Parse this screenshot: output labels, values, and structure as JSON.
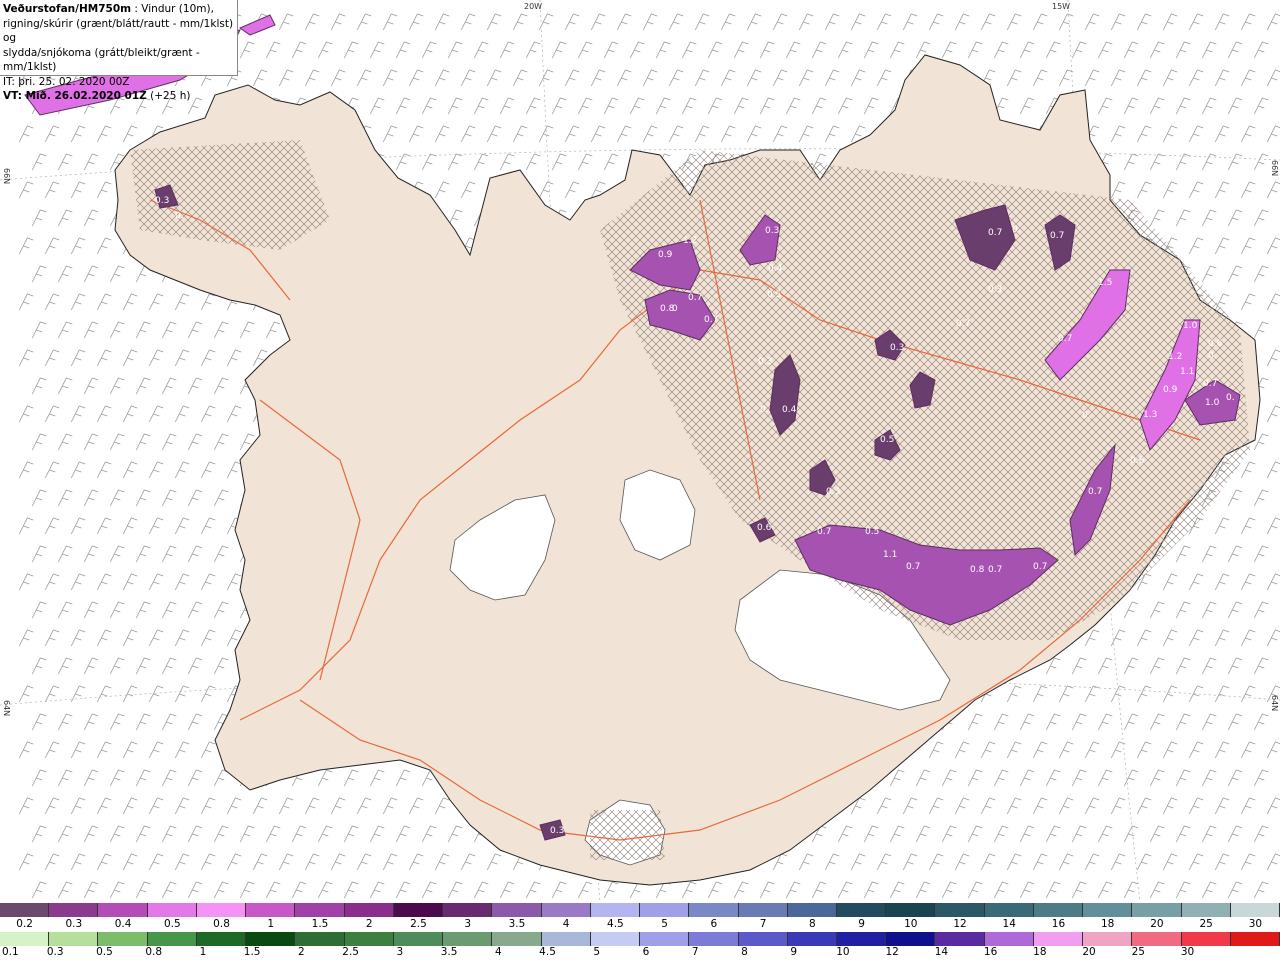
{
  "title": {
    "bold": "Veðurstofan/HM750m",
    "line1": " : Vindur (10m),",
    "line2": "rigning/skúrir (grænt/blátt/rautt - mm/1klst) og",
    "line3": "slydda/snjókoma (grátt/bleikt/grænt - mm/1klst)",
    "line4": "IT: þri. 25. 02. 2020 00Z",
    "vt_bold": "VT: Mið. 26.02.2020 01Z",
    "vt_rest": " (+25 h)"
  },
  "coords": {
    "lon20": "20W",
    "lon15": "15W",
    "lat66_left": "66N",
    "lat66_right": "66N",
    "lat64_left": "64N",
    "lat64_right": "64N"
  },
  "colors": {
    "land": "#f1e4d6",
    "glacier": "#ffffff",
    "road": "#e8683a",
    "snow_dark": "#5e2e5f",
    "snow_mid": "#a552b0",
    "snow_light": "#e070e6"
  },
  "legend_snow": {
    "labels": [
      "0.2",
      "0.3",
      "0.4",
      "0.5",
      "0.8",
      "1",
      "1.5",
      "2",
      "2.5",
      "3",
      "3.5",
      "4",
      "4.5",
      "5",
      "6",
      "7",
      "8",
      "9",
      "10",
      "12",
      "14",
      "16",
      "18",
      "20",
      "25",
      "30"
    ],
    "colors": [
      "#6c4a6e",
      "#8c3a8e",
      "#b44cb8",
      "#e378e8",
      "#f592f5",
      "#c858c8",
      "#a040a8",
      "#8a2d8d",
      "#4a0a4c",
      "#6a2a72",
      "#8c5aaa",
      "#9a7ac6",
      "#b4b4ee",
      "#a0a0e6",
      "#7a88c8",
      "#6a7ab4",
      "#4a689a",
      "#234b60",
      "#1a4452",
      "#2a5866",
      "#3a6a78",
      "#4e7c86",
      "#62909a",
      "#76a0a6",
      "#90b0b4",
      "#c8d8d8"
    ]
  },
  "legend_rain": {
    "labels": [
      "0.1",
      "0.3",
      "0.5",
      "0.8",
      "1",
      "1.5",
      "2",
      "2.5",
      "3",
      "3.5",
      "4",
      "4.5",
      "5",
      "6",
      "7",
      "8",
      "9",
      "10",
      "12",
      "14",
      "16",
      "18",
      "20",
      "25",
      "30"
    ],
    "colors": [
      "#d4f4c8",
      "#b4e09c",
      "#7cbc6a",
      "#48964a",
      "#1e6a24",
      "#0a4a10",
      "#2e6e34",
      "#3c8040",
      "#4e8c5a",
      "#6a9c70",
      "#88aa8c",
      "#a8b8d8",
      "#c4ccf4",
      "#a0a0e8",
      "#7c7cd8",
      "#5a5ac8",
      "#3a3ab8",
      "#2020a4",
      "#10108c",
      "#5a2aa0",
      "#b06ad8",
      "#f09ef0",
      "#f0a4c4",
      "#f06a80",
      "#f03a4a",
      "#e01a1a"
    ]
  }
}
